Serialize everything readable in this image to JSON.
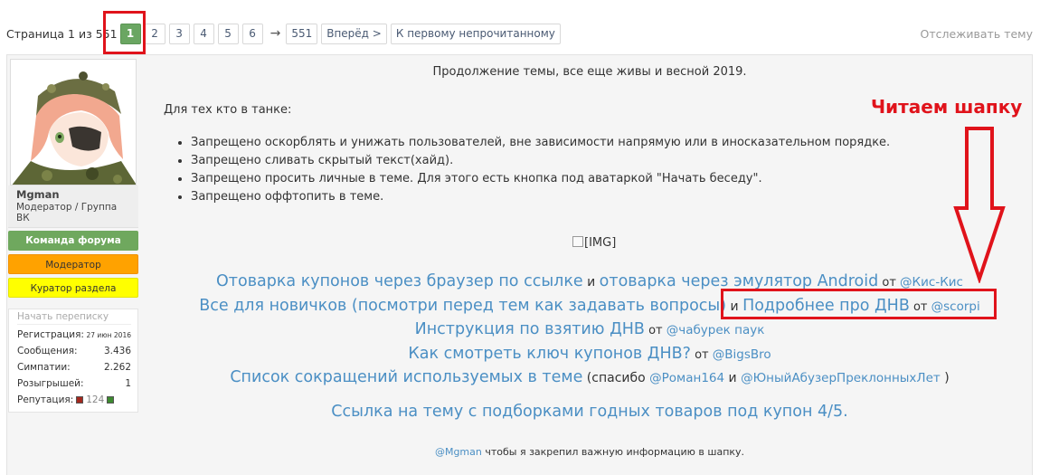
{
  "pager": {
    "label": "Страница 1 из 551",
    "pages": [
      "1",
      "2",
      "3",
      "4",
      "5",
      "6"
    ],
    "arrow": "→",
    "last": "551",
    "next": "Вперёд >",
    "first_unread": "К первому непрочитанному",
    "watch": "Отслеживать тему"
  },
  "user": {
    "name": "Mgman",
    "title": "Модератор / Группа ВК",
    "banners": [
      "Команда форума",
      "Модератор",
      "Куратор раздела"
    ],
    "stats_header": "Начать переписку",
    "stats": [
      {
        "label": "Регистрация:",
        "value": "27 июн 2016"
      },
      {
        "label": "Сообщения:",
        "value": "3.436"
      },
      {
        "label": "Симпатии:",
        "value": "2.262"
      },
      {
        "label": "Розыгрышей:",
        "value": "1"
      }
    ],
    "rep_label": "Репутация:",
    "rep_value": "124"
  },
  "post": {
    "intro": "Продолжение темы, все еще живы и весной 2019.",
    "tank": "Для тех кто в танке:",
    "rules": [
      "Запрещено оскорблять и унижать пользователей, вне зависимости напрямую или в иносказательном порядке.",
      "Запрещено сливать скрытый текст(хайд).",
      "Запрещено просить личные в теме. Для этого есть кнопка под аватаркой \"Начать беседу\".",
      "Запрещено оффтопить в теме."
    ],
    "img_placeholder": "[IMG]",
    "lines": {
      "l1a": "Отоварка купонов через браузер по ссылке",
      "l1and": " и ",
      "l1b": "отоварка через эмулятор Android",
      "l1ot": " от ",
      "l1m": "@Кис-Кис",
      "l2a": "Все для новичков (посмотри перед тем как задавать вопросы)",
      "l2and": " и ",
      "l2b": "Подробнее про ДНВ",
      "l2ot": " от ",
      "l2m": "@scorpi",
      "l3a": "Инструкция по взятию ДНВ",
      "l3ot": " от ",
      "l3m": "@чабурек паук",
      "l4a": "Как смотреть ключ купонов ДНВ?",
      "l4ot": " от ",
      "l4m": "@BigsBro",
      "l5a": "Список сокращений используемых в теме",
      "l5thanks": " (спасибо ",
      "l5m1": "@Роман164",
      "l5and": " и ",
      "l5m2": "@ЮныйАбузерПреклонныхЛет",
      "l5close": " )"
    },
    "big_link": "Ссылка на тему с подборками годных товаров под купон 4/5.",
    "footer_mention": "@Mgman",
    "footer_text": " чтобы я закрепил важную информацию в шапку."
  },
  "annotation": {
    "text": "Читаем шапку",
    "color": "#e0131b"
  },
  "colors": {
    "accent_green": "#6aa662",
    "link_blue": "#4b8fc4",
    "annotation_red": "#e0131b"
  }
}
